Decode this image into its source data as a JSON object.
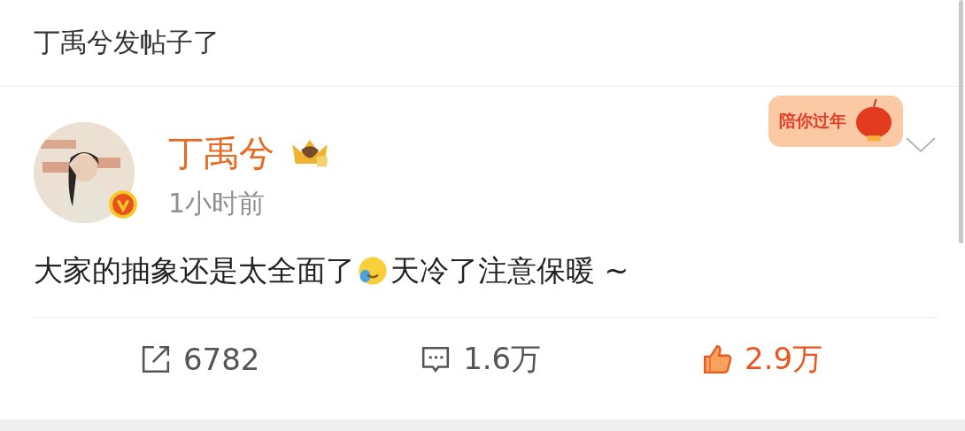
{
  "header": {
    "title": "丁禹兮发帖子了"
  },
  "post": {
    "author": "丁禹兮",
    "verified": true,
    "badge": "陪你过年",
    "time": "1小时前",
    "text": "大家的抽象还是太全面了",
    "text_after": "天冷了注意保暖 ~",
    "actions": [
      {
        "kind": "repost",
        "count": "6782",
        "selected": false
      },
      {
        "kind": "comment",
        "count": "1.6万",
        "selected": false
      },
      {
        "kind": "like",
        "count": "2.9万",
        "selected": true
      }
    ]
  }
}
